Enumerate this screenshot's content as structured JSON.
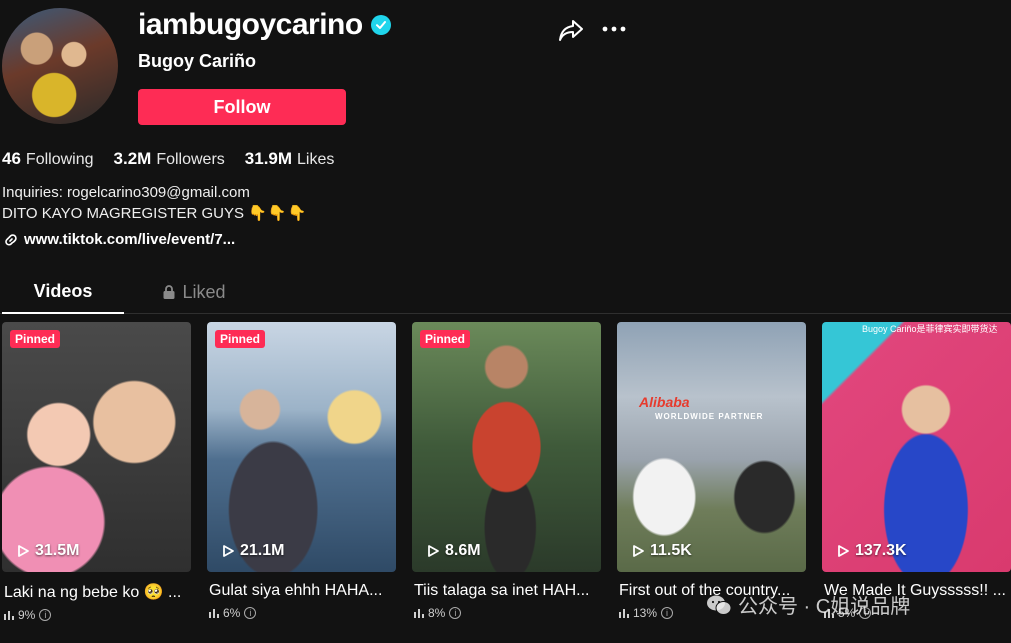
{
  "profile": {
    "username": "iambugoycarino",
    "nickname": "Bugoy Cariño",
    "follow_label": "Follow",
    "verified": true
  },
  "stats": [
    {
      "value": "46",
      "label": "Following"
    },
    {
      "value": "3.2M",
      "label": "Followers"
    },
    {
      "value": "31.9M",
      "label": "Likes"
    }
  ],
  "bio": {
    "line1": "Inquiries: rogelcarino309@gmail.com",
    "line2": "DITO KAYO MAGREGISTER GUYS",
    "line2_emoji": "👇👇👇",
    "link": "www.tiktok.com/live/event/7..."
  },
  "tabs": {
    "videos": "Videos",
    "liked": "Liked"
  },
  "videos": [
    {
      "pinned": "Pinned",
      "views": "31.5M",
      "caption": "Laki na ng bebe ko 🥺 ...",
      "pct": "9%"
    },
    {
      "pinned": "Pinned",
      "views": "21.1M",
      "caption": "Gulat siya ehhh HAHA...",
      "pct": "6%"
    },
    {
      "pinned": "Pinned",
      "views": "8.6M",
      "caption": "Tiis talaga sa inet HAH...",
      "pct": "8%"
    },
    {
      "views": "11.5K",
      "caption": "First out of the country...",
      "pct": "13%",
      "overlay_text": "Alibaba",
      "overlay_sub": "WORLDWIDE PARTNER"
    },
    {
      "views": "137.3K",
      "caption": "We Made It Guysssss!! ...",
      "pct": "5%",
      "overlay_text": "Bugoy Cariño是菲律宾实即带货达"
    }
  ],
  "watermark": "公众号 · C姐说品牌",
  "colors": {
    "background": "#121212",
    "accent": "#fe2c55",
    "verified": "#20d5ec"
  }
}
